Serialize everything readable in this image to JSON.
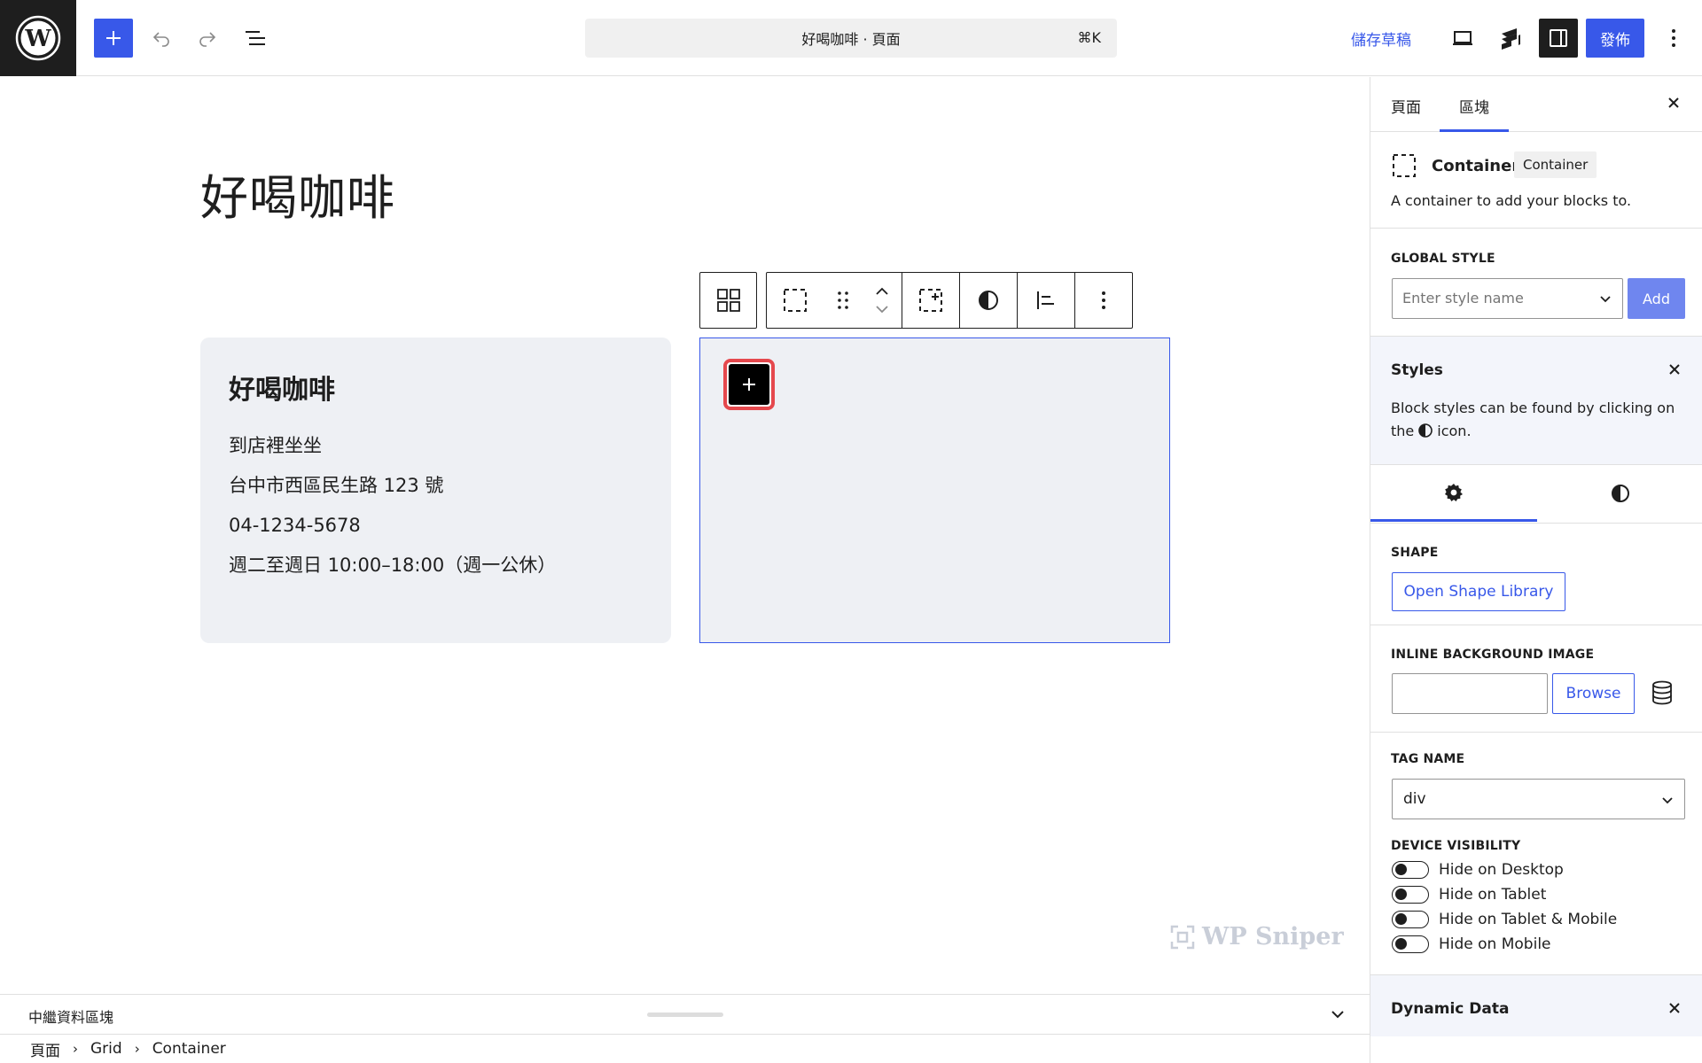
{
  "topbar": {
    "doc_title": "好喝咖啡 · 頁面",
    "shortcut": "⌘K",
    "save_draft": "儲存草稿",
    "publish": "發佈"
  },
  "editor": {
    "page_title": "好喝咖啡",
    "card": {
      "title": "好喝咖啡",
      "lines": [
        "到店裡坐坐",
        "台中市西區民生路 123 號",
        "04-1234-5678",
        "週二至週日 10:00–18:00（週一公休）"
      ]
    },
    "watermark": "WP Sniper"
  },
  "footer": {
    "panel_label": "中繼資料區塊",
    "breadcrumb": [
      "頁面",
      "Grid",
      "Container"
    ]
  },
  "sidebar": {
    "tabs": [
      "頁面",
      "區塊"
    ],
    "active_tab": "區塊",
    "block": {
      "name": "Container",
      "badge": "Container",
      "description": "A container to add your blocks to."
    },
    "global_style": {
      "label": "GLOBAL STYLE",
      "placeholder": "Enter style name",
      "add_label": "Add"
    },
    "styles_notice": {
      "title": "Styles",
      "text_before": "Block styles can be found by clicking on the",
      "text_after": "icon."
    },
    "shape": {
      "label": "SHAPE",
      "button": "Open Shape Library"
    },
    "inline_bg": {
      "label": "INLINE BACKGROUND IMAGE",
      "browse": "Browse"
    },
    "tag_name": {
      "label": "TAG NAME",
      "value": "div"
    },
    "device_visibility": {
      "label": "DEVICE VISIBILITY",
      "options": [
        {
          "label": "Hide on Desktop",
          "on": false
        },
        {
          "label": "Hide on Tablet",
          "on": false
        },
        {
          "label": "Hide on Tablet & Mobile",
          "on": false
        },
        {
          "label": "Hide on Mobile",
          "on": false
        }
      ]
    },
    "dynamic_data": {
      "title": "Dynamic Data"
    }
  },
  "colors": {
    "accent": "#3858e9",
    "highlight": "#e5484d",
    "card_bg": "#eef0f4"
  }
}
